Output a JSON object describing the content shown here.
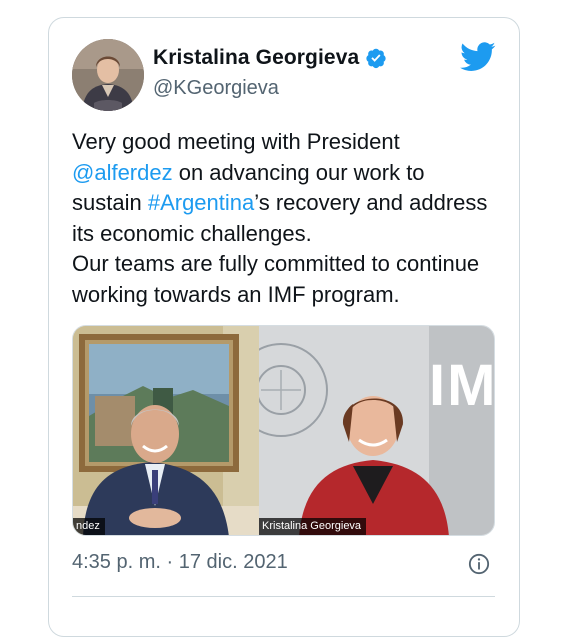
{
  "author": {
    "name": "Kristalina Georgieva",
    "handle": "@KGeorgieva"
  },
  "tweet": {
    "segments": [
      {
        "text": "Very good meeting with President\n",
        "link": false
      },
      {
        "text": "@alferdez",
        "link": true
      },
      {
        "text": " on advancing our work to\nsustain ",
        "link": false
      },
      {
        "text": "#Argentina",
        "link": true
      },
      {
        "text": "’s recovery and address\nits economic challenges.\nOur teams are fully committed to continue\nworking towards an IMF program.",
        "link": false
      }
    ]
  },
  "media": {
    "left_caption": "ndez",
    "right_caption": "Kristalina Georgieva",
    "imf_letters": "IM"
  },
  "meta": {
    "time": "4:35 p. m.",
    "separator": " · ",
    "date": "17 dic. 2021"
  },
  "icons": {
    "verified": "verified-badge-icon",
    "twitter": "twitter-bird-icon",
    "info": "info-icon"
  },
  "colors": {
    "link": "#1d9bf0",
    "text": "#0f1419",
    "muted": "#536471",
    "verified": "#1d9bf0"
  }
}
